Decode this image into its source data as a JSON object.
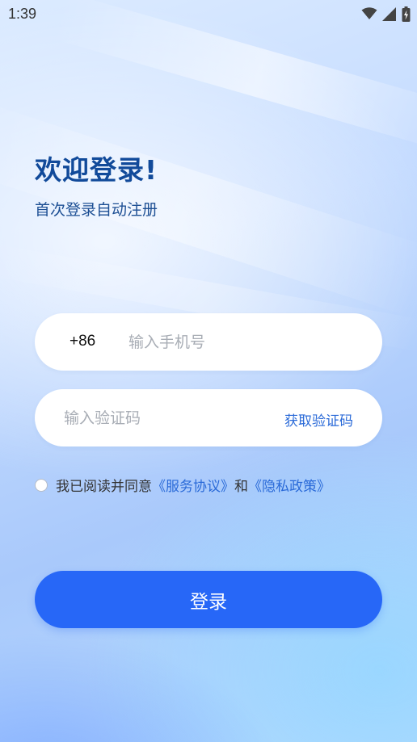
{
  "status_bar": {
    "time": "1:39",
    "icons": [
      "wifi-icon",
      "cellular-signal-icon",
      "battery-charging-icon"
    ]
  },
  "welcome": {
    "title": "欢迎登录!",
    "subtitle": "首次登录自动注册"
  },
  "phone": {
    "country_code": "+86",
    "placeholder": "输入手机号",
    "value": ""
  },
  "verification": {
    "placeholder": "输入验证码",
    "value": "",
    "get_code_label": "获取验证码"
  },
  "agreement": {
    "checked": false,
    "prefix": "我已阅读并同意",
    "service_link": "《服务协议》",
    "conjunction": "和",
    "privacy_link": "《隐私政策》"
  },
  "login_button": {
    "label": "登录"
  },
  "colors": {
    "primary": "#2767f7",
    "link": "#2a6ad8",
    "title": "#114a9a"
  }
}
